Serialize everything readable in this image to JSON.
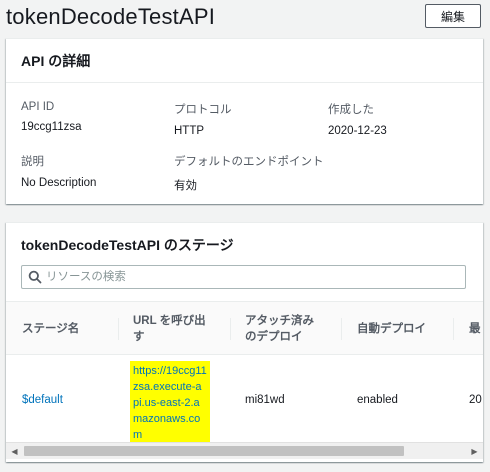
{
  "page": {
    "title": "tokenDecodeTestAPI",
    "edit_label": "編集"
  },
  "details": {
    "header": "API の詳細",
    "fields": [
      {
        "label": "API ID",
        "value": "19ccg11zsa"
      },
      {
        "label": "プロトコル",
        "value": "HTTP"
      },
      {
        "label": "作成した",
        "value": "2020-12-23"
      },
      {
        "label": "説明",
        "value": "No Description"
      },
      {
        "label": "デフォルトのエンドポイント",
        "value": "有効"
      }
    ]
  },
  "stages": {
    "title": "tokenDecodeTestAPI のステージ",
    "search_placeholder": "リソースの検索",
    "columns": [
      {
        "line1": "ステージ名",
        "line2": ""
      },
      {
        "line1": "URL を呼び出",
        "line2": "す"
      },
      {
        "line1": "アタッチ済み",
        "line2": "のデプロイ"
      },
      {
        "line1": "自動デプロイ",
        "line2": ""
      },
      {
        "line1": "最",
        "line2": ""
      }
    ],
    "rows": [
      {
        "stage_name": "$default",
        "invoke_url": "https://19ccg11zsa.execute-api.us-east-2.amazonaws.com",
        "deployment": "mi81wd",
        "auto_deploy": "enabled",
        "last": "20"
      }
    ],
    "highlight_color": "#ffff00"
  },
  "colors": {
    "link": "#0073bb",
    "text": "#16191f",
    "muted": "#545b64",
    "background": "#f2f3f3"
  }
}
